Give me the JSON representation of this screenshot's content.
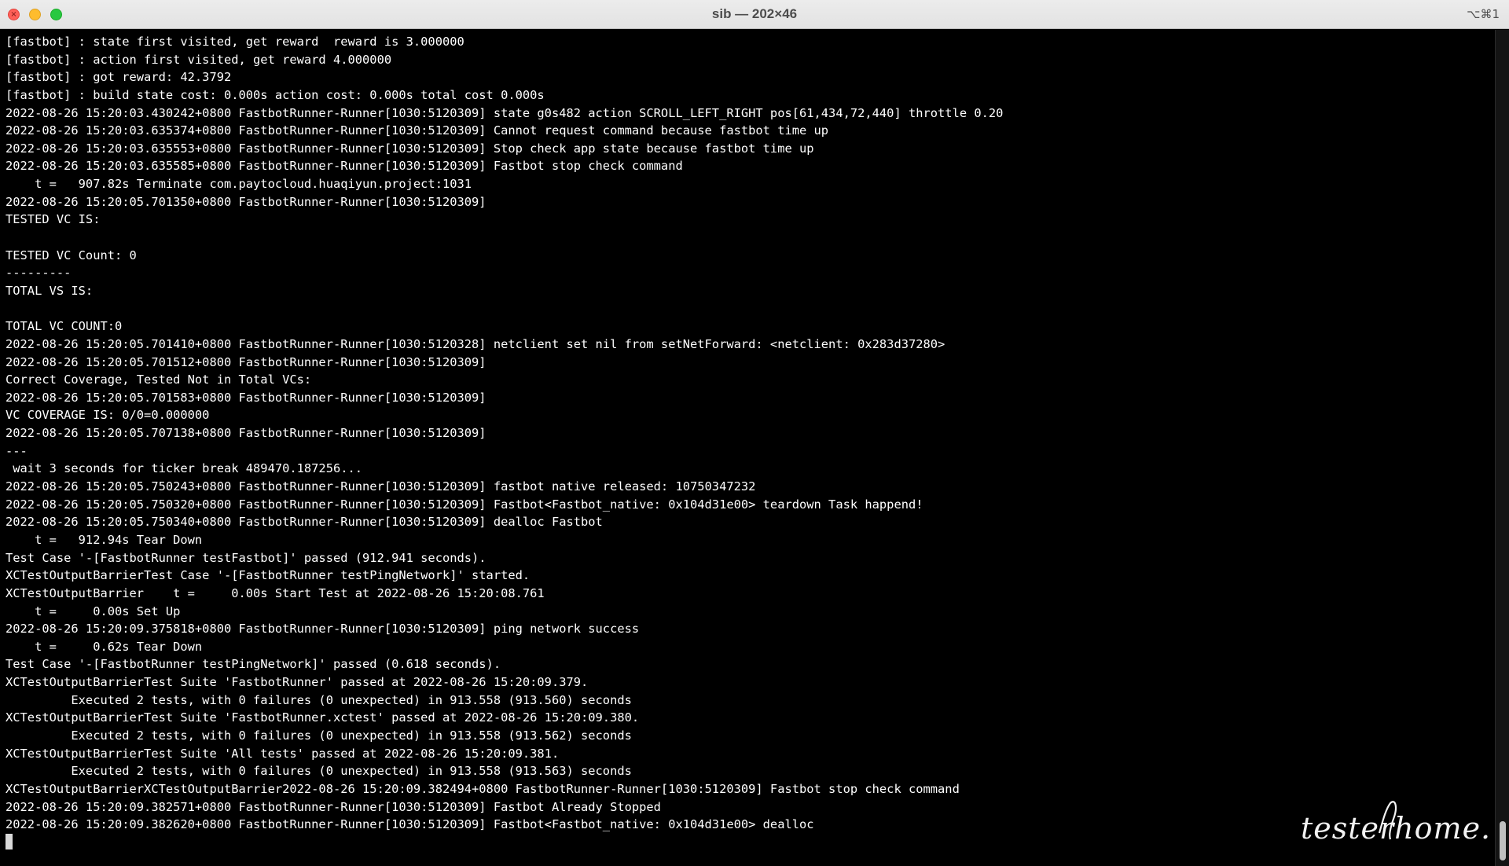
{
  "window": {
    "title": "sib — 202×46",
    "shortcut": "⌥⌘1"
  },
  "terminal": {
    "lines": [
      "[fastbot] : state first visited, get reward  reward is 3.000000",
      "[fastbot] : action first visited, get reward 4.000000",
      "[fastbot] : got reward: 42.3792",
      "[fastbot] : build state cost: 0.000s action cost: 0.000s total cost 0.000s",
      "2022-08-26 15:20:03.430242+0800 FastbotRunner-Runner[1030:5120309] state g0s482 action SCROLL_LEFT_RIGHT pos[61,434,72,440] throttle 0.20",
      "2022-08-26 15:20:03.635374+0800 FastbotRunner-Runner[1030:5120309] Cannot request command because fastbot time up",
      "2022-08-26 15:20:03.635553+0800 FastbotRunner-Runner[1030:5120309] Stop check app state because fastbot time up",
      "2022-08-26 15:20:03.635585+0800 FastbotRunner-Runner[1030:5120309] Fastbot stop check command",
      "    t =   907.82s Terminate com.paytocloud.huaqiyun.project:1031",
      "2022-08-26 15:20:05.701350+0800 FastbotRunner-Runner[1030:5120309]",
      "TESTED VC IS:",
      "",
      "TESTED VC Count: 0",
      "---------",
      "TOTAL VS IS:",
      "",
      "TOTAL VC COUNT:0",
      "2022-08-26 15:20:05.701410+0800 FastbotRunner-Runner[1030:5120328] netclient set nil from setNetForward: <netclient: 0x283d37280>",
      "2022-08-26 15:20:05.701512+0800 FastbotRunner-Runner[1030:5120309]",
      "Correct Coverage, Tested Not in Total VCs:",
      "2022-08-26 15:20:05.701583+0800 FastbotRunner-Runner[1030:5120309]",
      "VC COVERAGE IS: 0/0=0.000000",
      "2022-08-26 15:20:05.707138+0800 FastbotRunner-Runner[1030:5120309]",
      "---",
      " wait 3 seconds for ticker break 489470.187256...",
      "2022-08-26 15:20:05.750243+0800 FastbotRunner-Runner[1030:5120309] fastbot native released: 10750347232",
      "2022-08-26 15:20:05.750320+0800 FastbotRunner-Runner[1030:5120309] Fastbot<Fastbot_native: 0x104d31e00> teardown Task happend!",
      "2022-08-26 15:20:05.750340+0800 FastbotRunner-Runner[1030:5120309] dealloc Fastbot",
      "    t =   912.94s Tear Down",
      "Test Case '-[FastbotRunner testFastbot]' passed (912.941 seconds).",
      "XCTestOutputBarrierTest Case '-[FastbotRunner testPingNetwork]' started.",
      "XCTestOutputBarrier    t =     0.00s Start Test at 2022-08-26 15:20:08.761",
      "    t =     0.00s Set Up",
      "2022-08-26 15:20:09.375818+0800 FastbotRunner-Runner[1030:5120309] ping network success",
      "    t =     0.62s Tear Down",
      "Test Case '-[FastbotRunner testPingNetwork]' passed (0.618 seconds).",
      "XCTestOutputBarrierTest Suite 'FastbotRunner' passed at 2022-08-26 15:20:09.379.",
      "         Executed 2 tests, with 0 failures (0 unexpected) in 913.558 (913.560) seconds",
      "XCTestOutputBarrierTest Suite 'FastbotRunner.xctest' passed at 2022-08-26 15:20:09.380.",
      "         Executed 2 tests, with 0 failures (0 unexpected) in 913.558 (913.562) seconds",
      "XCTestOutputBarrierTest Suite 'All tests' passed at 2022-08-26 15:20:09.381.",
      "         Executed 2 tests, with 0 failures (0 unexpected) in 913.558 (913.563) seconds",
      "XCTestOutputBarrierXCTestOutputBarrier2022-08-26 15:20:09.382494+0800 FastbotRunner-Runner[1030:5120309] Fastbot stop check command",
      "2022-08-26 15:20:09.382571+0800 FastbotRunner-Runner[1030:5120309] Fastbot Already Stopped",
      "2022-08-26 15:20:09.382620+0800 FastbotRunner-Runner[1030:5120309] Fastbot<Fastbot_native: 0x104d31e00> dealloc"
    ]
  },
  "watermark": {
    "text": "testerhome.co"
  },
  "colors": {
    "background": "#000000",
    "text": "#ffffff",
    "titlebar": "#e6e6e6",
    "close": "#ff5f57",
    "minimize": "#febc2e",
    "maximize": "#28c840"
  },
  "icons": {
    "close": "close-icon",
    "minimize": "minimize-icon",
    "maximize": "maximize-icon"
  }
}
